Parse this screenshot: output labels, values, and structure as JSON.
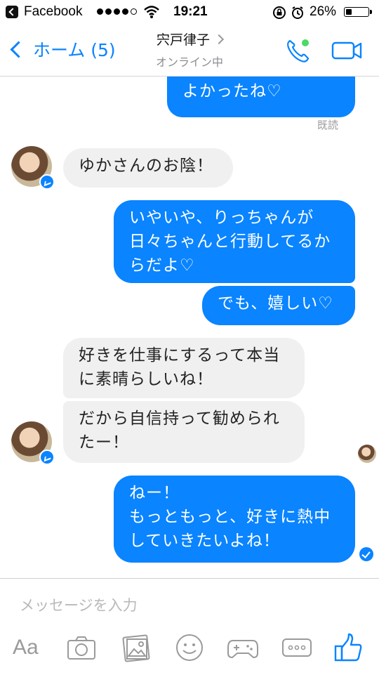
{
  "status_bar": {
    "app": "Facebook",
    "time": "19:21",
    "battery": "26%",
    "battery_level": 0.26,
    "signal_bars": 4
  },
  "nav": {
    "back_label": "ホーム (5)",
    "contact_name": "宍戸律子",
    "contact_status": "オンライン中",
    "accent_color": "#0a84ff",
    "online_color": "#4cd964"
  },
  "chat": {
    "read_label": "既読",
    "messages": [
      {
        "direction": "out",
        "text": "よかったね♡"
      },
      {
        "direction": "in",
        "text": "ゆかさんのお陰！"
      },
      {
        "direction": "out",
        "text": "いやいや、りっちゃんが\n日々ちゃんと行動してるか\nらだよ♡"
      },
      {
        "direction": "out",
        "text": "でも、嬉しい♡"
      },
      {
        "direction": "in",
        "text": "好きを仕事にするって本当\nに素晴らしいね！"
      },
      {
        "direction": "in",
        "text": "だから自信持って勧められ\nたー！"
      },
      {
        "direction": "out",
        "text": "ねー！\nもっともっと、好きに熱中\nしていきたいよね！"
      }
    ]
  },
  "composer": {
    "placeholder": "メッセージを入力",
    "aa_label": "Aa",
    "tools": [
      "text-format-icon",
      "camera-icon",
      "photo-icon",
      "sticker-icon",
      "game-icon",
      "more-icon",
      "like-icon"
    ]
  }
}
